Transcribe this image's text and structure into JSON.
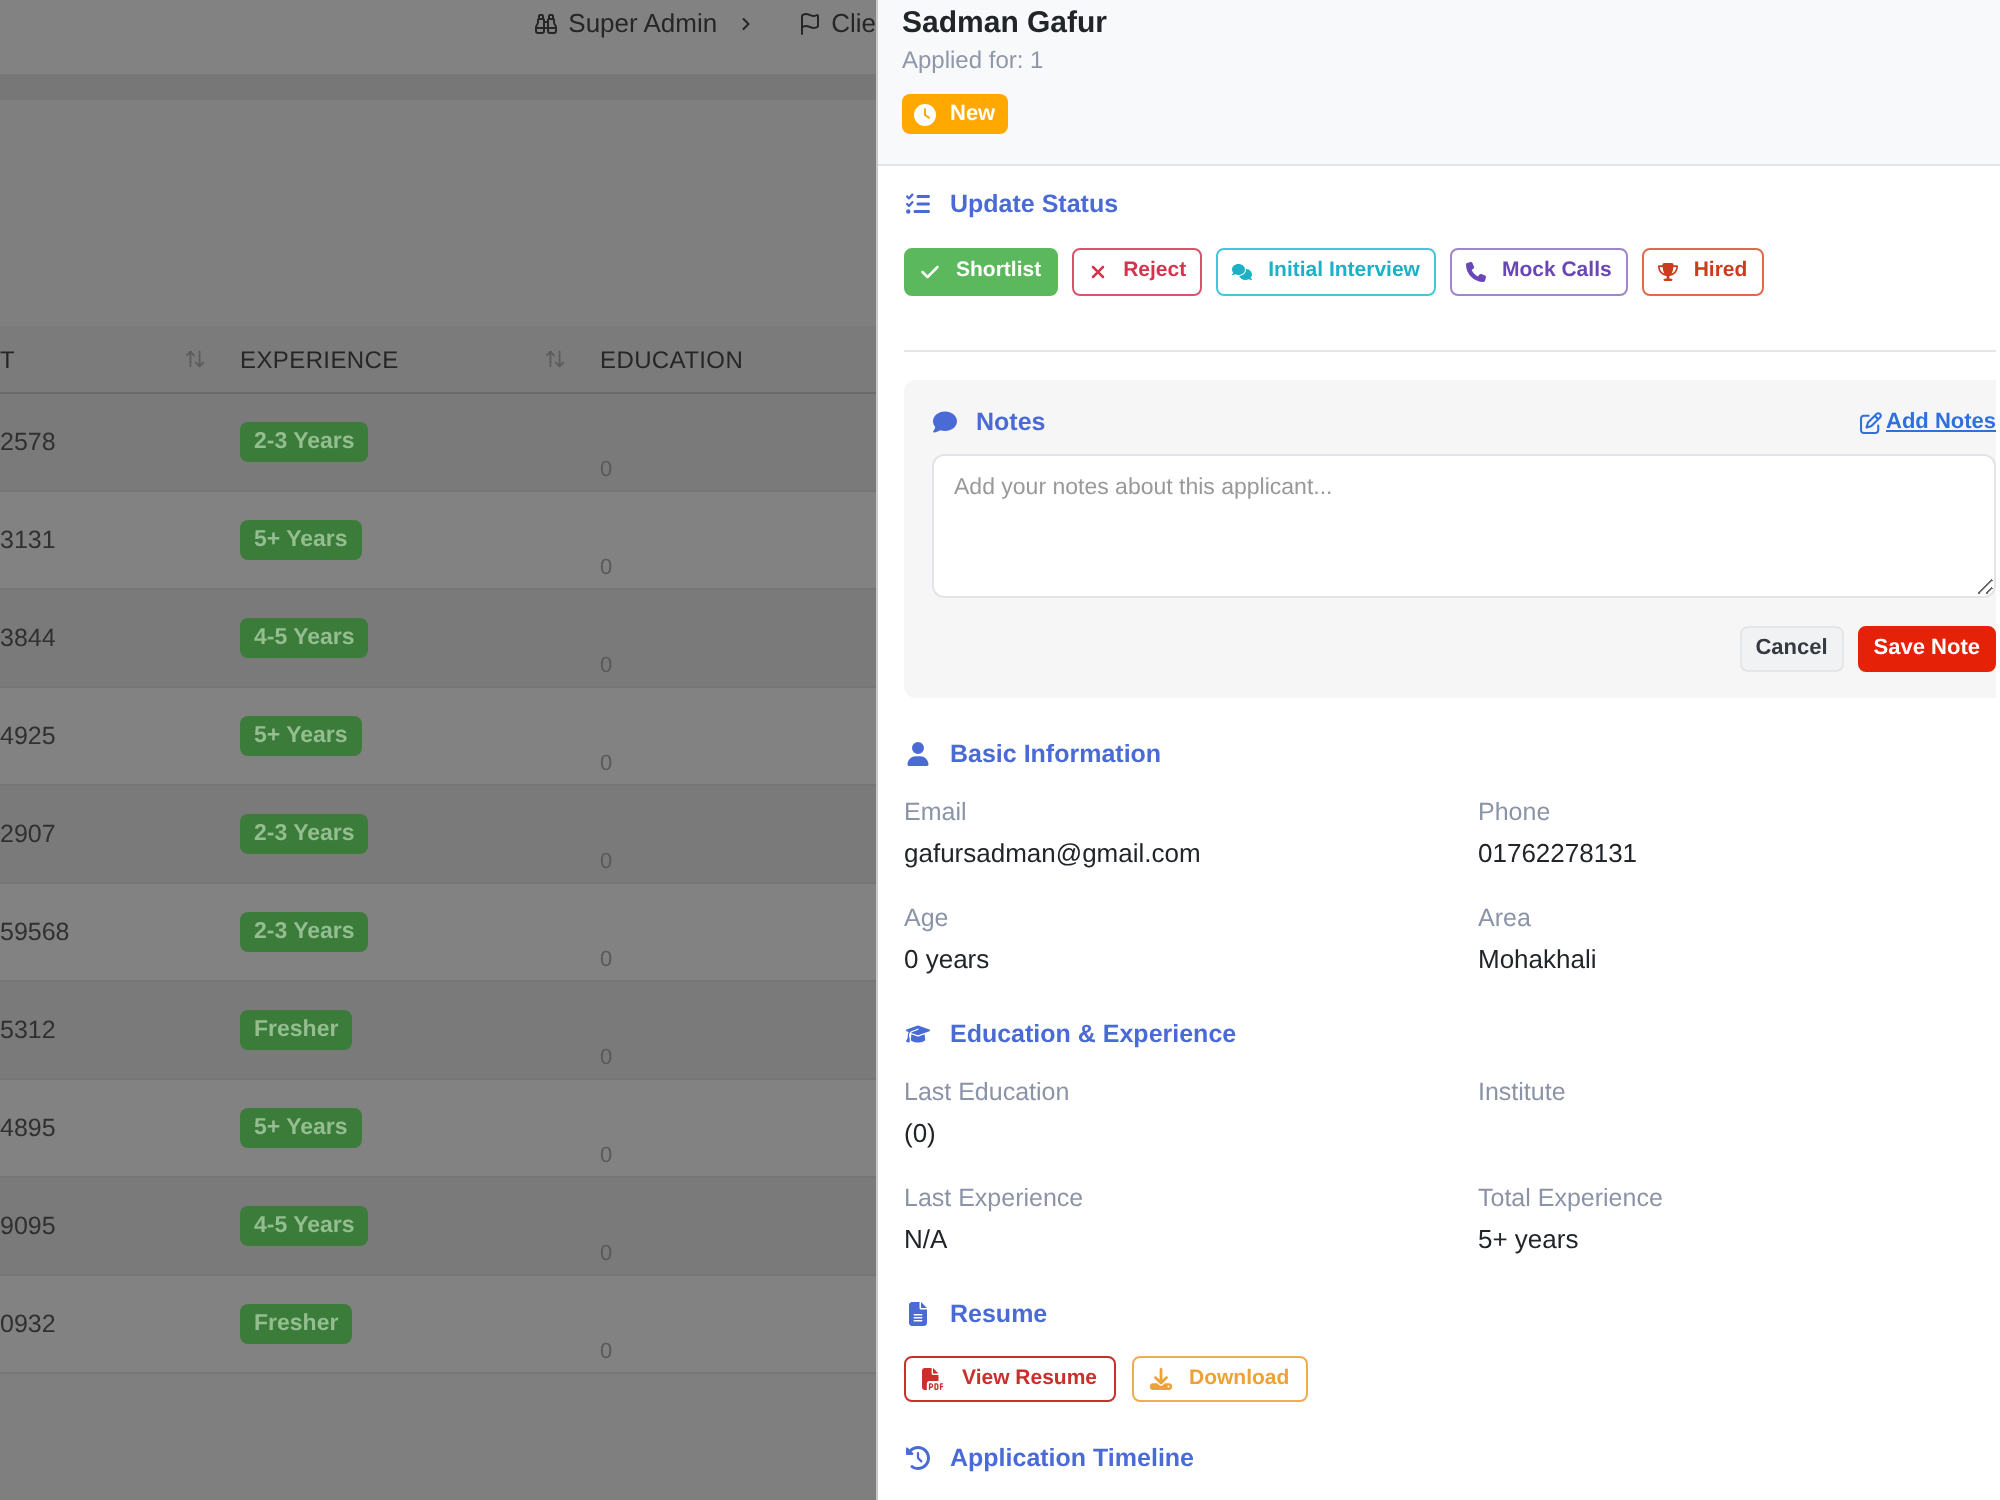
{
  "top_bar": {
    "breadcrumbs": [
      {
        "label": "Super Admin",
        "kind": "admin"
      },
      {
        "label": "Clie",
        "kind": "flagged"
      }
    ]
  },
  "table": {
    "columns": [
      {
        "label": "T",
        "sortable": true
      },
      {
        "label": "EXPERIENCE",
        "sortable": true
      },
      {
        "label": "EDUCATION"
      }
    ],
    "rows": [
      {
        "cells": [
          "2578",
          "2-3 Years",
          "0"
        ]
      },
      {
        "cells": [
          "3131",
          "5+ Years",
          "0"
        ]
      },
      {
        "cells": [
          "3844",
          "4-5 Years",
          "0"
        ]
      },
      {
        "cells": [
          "4925",
          "5+ Years",
          "0"
        ]
      },
      {
        "cells": [
          "2907",
          "2-3 Years",
          "0"
        ]
      },
      {
        "cells": [
          "59568",
          "2-3 Years",
          "0"
        ]
      },
      {
        "cells": [
          "5312",
          "Fresher",
          "0"
        ]
      },
      {
        "cells": [
          "4895",
          "5+ Years",
          "0"
        ]
      },
      {
        "cells": [
          "9095",
          "4-5 Years",
          "0"
        ]
      },
      {
        "cells": [
          "0932",
          "Fresher",
          "0"
        ]
      }
    ]
  },
  "drawer": {
    "name": "Sadman Gafur",
    "applied_for": "Applied for: 1",
    "status_badge": {
      "label": "New"
    },
    "update_status": {
      "title": "Update Status",
      "buttons": [
        {
          "label": "Shortlist",
          "kind": "shortlist",
          "selected": true
        },
        {
          "label": "Reject",
          "kind": "reject",
          "selected": false
        },
        {
          "label": "Initial Interview",
          "kind": "interview",
          "selected": false
        },
        {
          "label": "Mock Calls",
          "kind": "call",
          "selected": false
        },
        {
          "label": "Hired",
          "kind": "hired",
          "selected": false
        }
      ]
    },
    "notes": {
      "title": "Notes",
      "add_link": "Add Notes",
      "textarea": {
        "placeholder": "Add your notes about this applicant..."
      },
      "buttons": [
        {
          "label": "Cancel",
          "kind": "secondary"
        },
        {
          "label": "Save Note",
          "kind": "primary"
        }
      ]
    },
    "basic_information": {
      "title": "Basic Information",
      "fields": [
        {
          "label": "Email",
          "value": "gafursadman@gmail.com"
        },
        {
          "label": "Phone",
          "value": "01762278131"
        },
        {
          "label": "Age",
          "value": "0 years"
        },
        {
          "label": "Area",
          "value": "Mohakhali"
        }
      ]
    },
    "education_experience": {
      "title": "Education & Experience",
      "fields": [
        {
          "label": "Last Education",
          "value": "(0)"
        },
        {
          "label": "Institute"
        },
        {
          "label": "Last Experience",
          "value": "N/A"
        },
        {
          "label": "Total Experience",
          "value": "5+ years"
        }
      ]
    },
    "resume": {
      "title": "Resume",
      "buttons": [
        {
          "label": "View Resume",
          "kind": "view"
        },
        {
          "label": "Download",
          "kind": "download"
        }
      ]
    },
    "application_timeline": {
      "title": "Application Timeline"
    }
  }
}
